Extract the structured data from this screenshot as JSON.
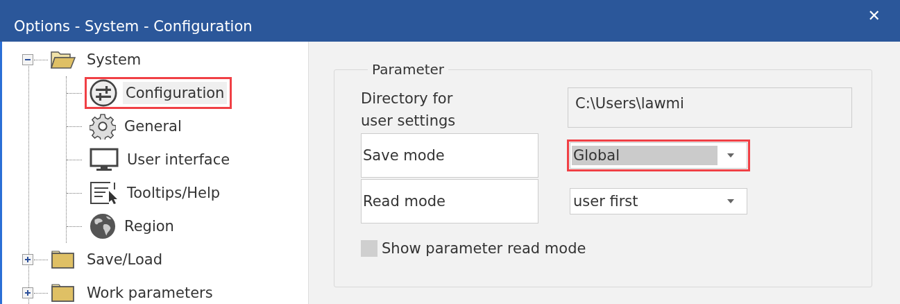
{
  "window": {
    "title": "Options - System - Configuration",
    "close": "✕"
  },
  "tree": [
    {
      "label": "System",
      "expanded": true,
      "children": [
        {
          "label": "Configuration",
          "kind": "sliders",
          "selected": true,
          "highlighted": true
        },
        {
          "label": "General",
          "kind": "gear",
          "selected": false,
          "highlighted": false
        },
        {
          "label": "User interface",
          "kind": "monitor",
          "selected": false,
          "highlighted": false
        },
        {
          "label": "Tooltips/Help",
          "kind": "tooltip",
          "selected": false,
          "highlighted": false
        },
        {
          "label": "Region",
          "kind": "globe",
          "selected": false,
          "highlighted": false
        }
      ]
    },
    {
      "label": "Save/Load",
      "expanded": false
    },
    {
      "label": "Work parameters",
      "expanded": false
    }
  ],
  "parameter": {
    "title": "Parameter",
    "fields": [
      {
        "kind": "text",
        "label": "Directory for\nuser settings",
        "value": "C:\\Users\\lawmi"
      },
      {
        "kind": "combo",
        "label": "Save mode",
        "value": "Global",
        "focused": true,
        "highlighted": true
      },
      {
        "kind": "combo",
        "label": "Read mode",
        "value": "user first",
        "focused": false,
        "highlighted": false
      }
    ],
    "checkbox": {
      "label": "Show parameter read mode",
      "checked": false,
      "disabled": true
    }
  }
}
